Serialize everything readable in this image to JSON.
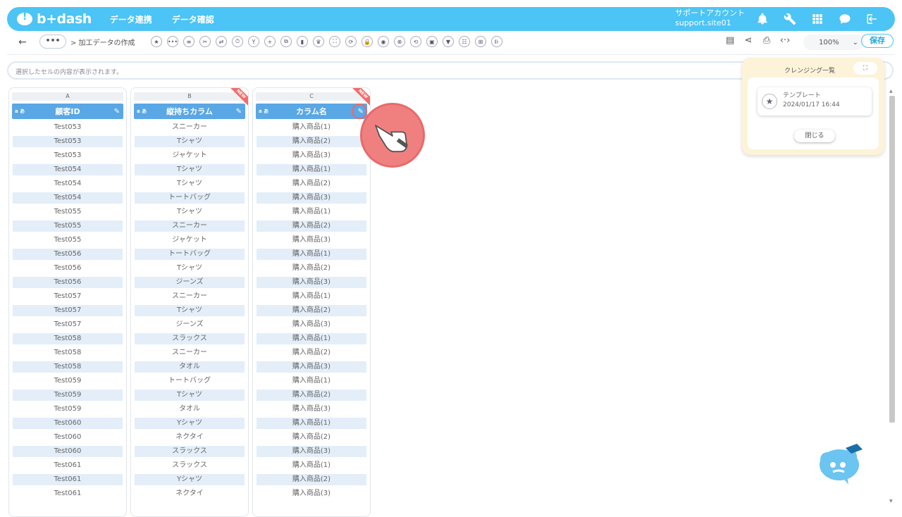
{
  "header": {
    "logo": "b+dash",
    "nav": [
      "データ連携",
      "データ確認"
    ],
    "account_name": "サポートアカウント",
    "account_site": "support.site01",
    "icons": [
      "bell-icon",
      "wrench-icon",
      "grid-icon",
      "chat-icon",
      "logout-icon"
    ]
  },
  "toolbar": {
    "back": "←",
    "more": "•••",
    "breadcrumb": "> 加工データの作成",
    "tools": [
      "★",
      "•••",
      "≡",
      "✂",
      "⇄",
      "⏱",
      "Y",
      "+",
      "⧉",
      "▮",
      "♛",
      "⛶",
      "⟳",
      "🔒",
      "◉",
      "⊗",
      "⟲",
      "▣",
      "▼",
      "☷",
      "⊞",
      "⊪"
    ],
    "zoom": "100%",
    "save": "保存"
  },
  "formula": {
    "placeholder": "選択したセルの内容が表示されます。"
  },
  "columns": [
    {
      "letter": "A",
      "header": "顧客ID",
      "type": "a あ",
      "is_new": false,
      "cells": [
        "Test053",
        "Test053",
        "Test053",
        "Test054",
        "Test054",
        "Test054",
        "Test055",
        "Test055",
        "Test055",
        "Test056",
        "Test056",
        "Test056",
        "Test057",
        "Test057",
        "Test057",
        "Test058",
        "Test058",
        "Test058",
        "Test059",
        "Test059",
        "Test059",
        "Test060",
        "Test060",
        "Test060",
        "Test061",
        "Test061",
        "Test061"
      ]
    },
    {
      "letter": "B",
      "header": "縦持ちカラム",
      "type": "a あ",
      "is_new": true,
      "cells": [
        "スニーカー",
        "Tシャツ",
        "ジャケット",
        "Tシャツ",
        "Tシャツ",
        "トートバッグ",
        "Tシャツ",
        "スニーカー",
        "ジャケット",
        "トートバッグ",
        "Tシャツ",
        "ジーンズ",
        "スニーカー",
        "Tシャツ",
        "ジーンズ",
        "スラックス",
        "スニーカー",
        "タオル",
        "トートバッグ",
        "Tシャツ",
        "タオル",
        "Yシャツ",
        "ネクタイ",
        "スラックス",
        "スラックス",
        "Yシャツ",
        "ネクタイ"
      ]
    },
    {
      "letter": "C",
      "header": "カラム名",
      "type": "a あ",
      "is_new": true,
      "cells": [
        "購入商品(1)",
        "購入商品(2)",
        "購入商品(3)",
        "購入商品(1)",
        "購入商品(2)",
        "購入商品(3)",
        "購入商品(1)",
        "購入商品(2)",
        "購入商品(3)",
        "購入商品(1)",
        "購入商品(2)",
        "購入商品(3)",
        "購入商品(1)",
        "購入商品(2)",
        "購入商品(3)",
        "購入商品(1)",
        "購入商品(2)",
        "購入商品(3)",
        "購入商品(1)",
        "購入商品(2)",
        "購入商品(3)",
        "購入商品(1)",
        "購入商品(2)",
        "購入商品(3)",
        "購入商品(1)",
        "購入商品(2)",
        "購入商品(3)"
      ]
    }
  ],
  "new_label": "NEW",
  "panel": {
    "title": "クレンジング一覧",
    "expand": "⛶",
    "template_name": "テンプレート",
    "template_date": "2024/01/17 16:44",
    "close": "閉じる"
  },
  "colors": {
    "header_bg": "#4cc4f5",
    "column_header": "#5aa7e6",
    "accent_red": "#f08080",
    "panel_bg": "#fdf3d9"
  }
}
